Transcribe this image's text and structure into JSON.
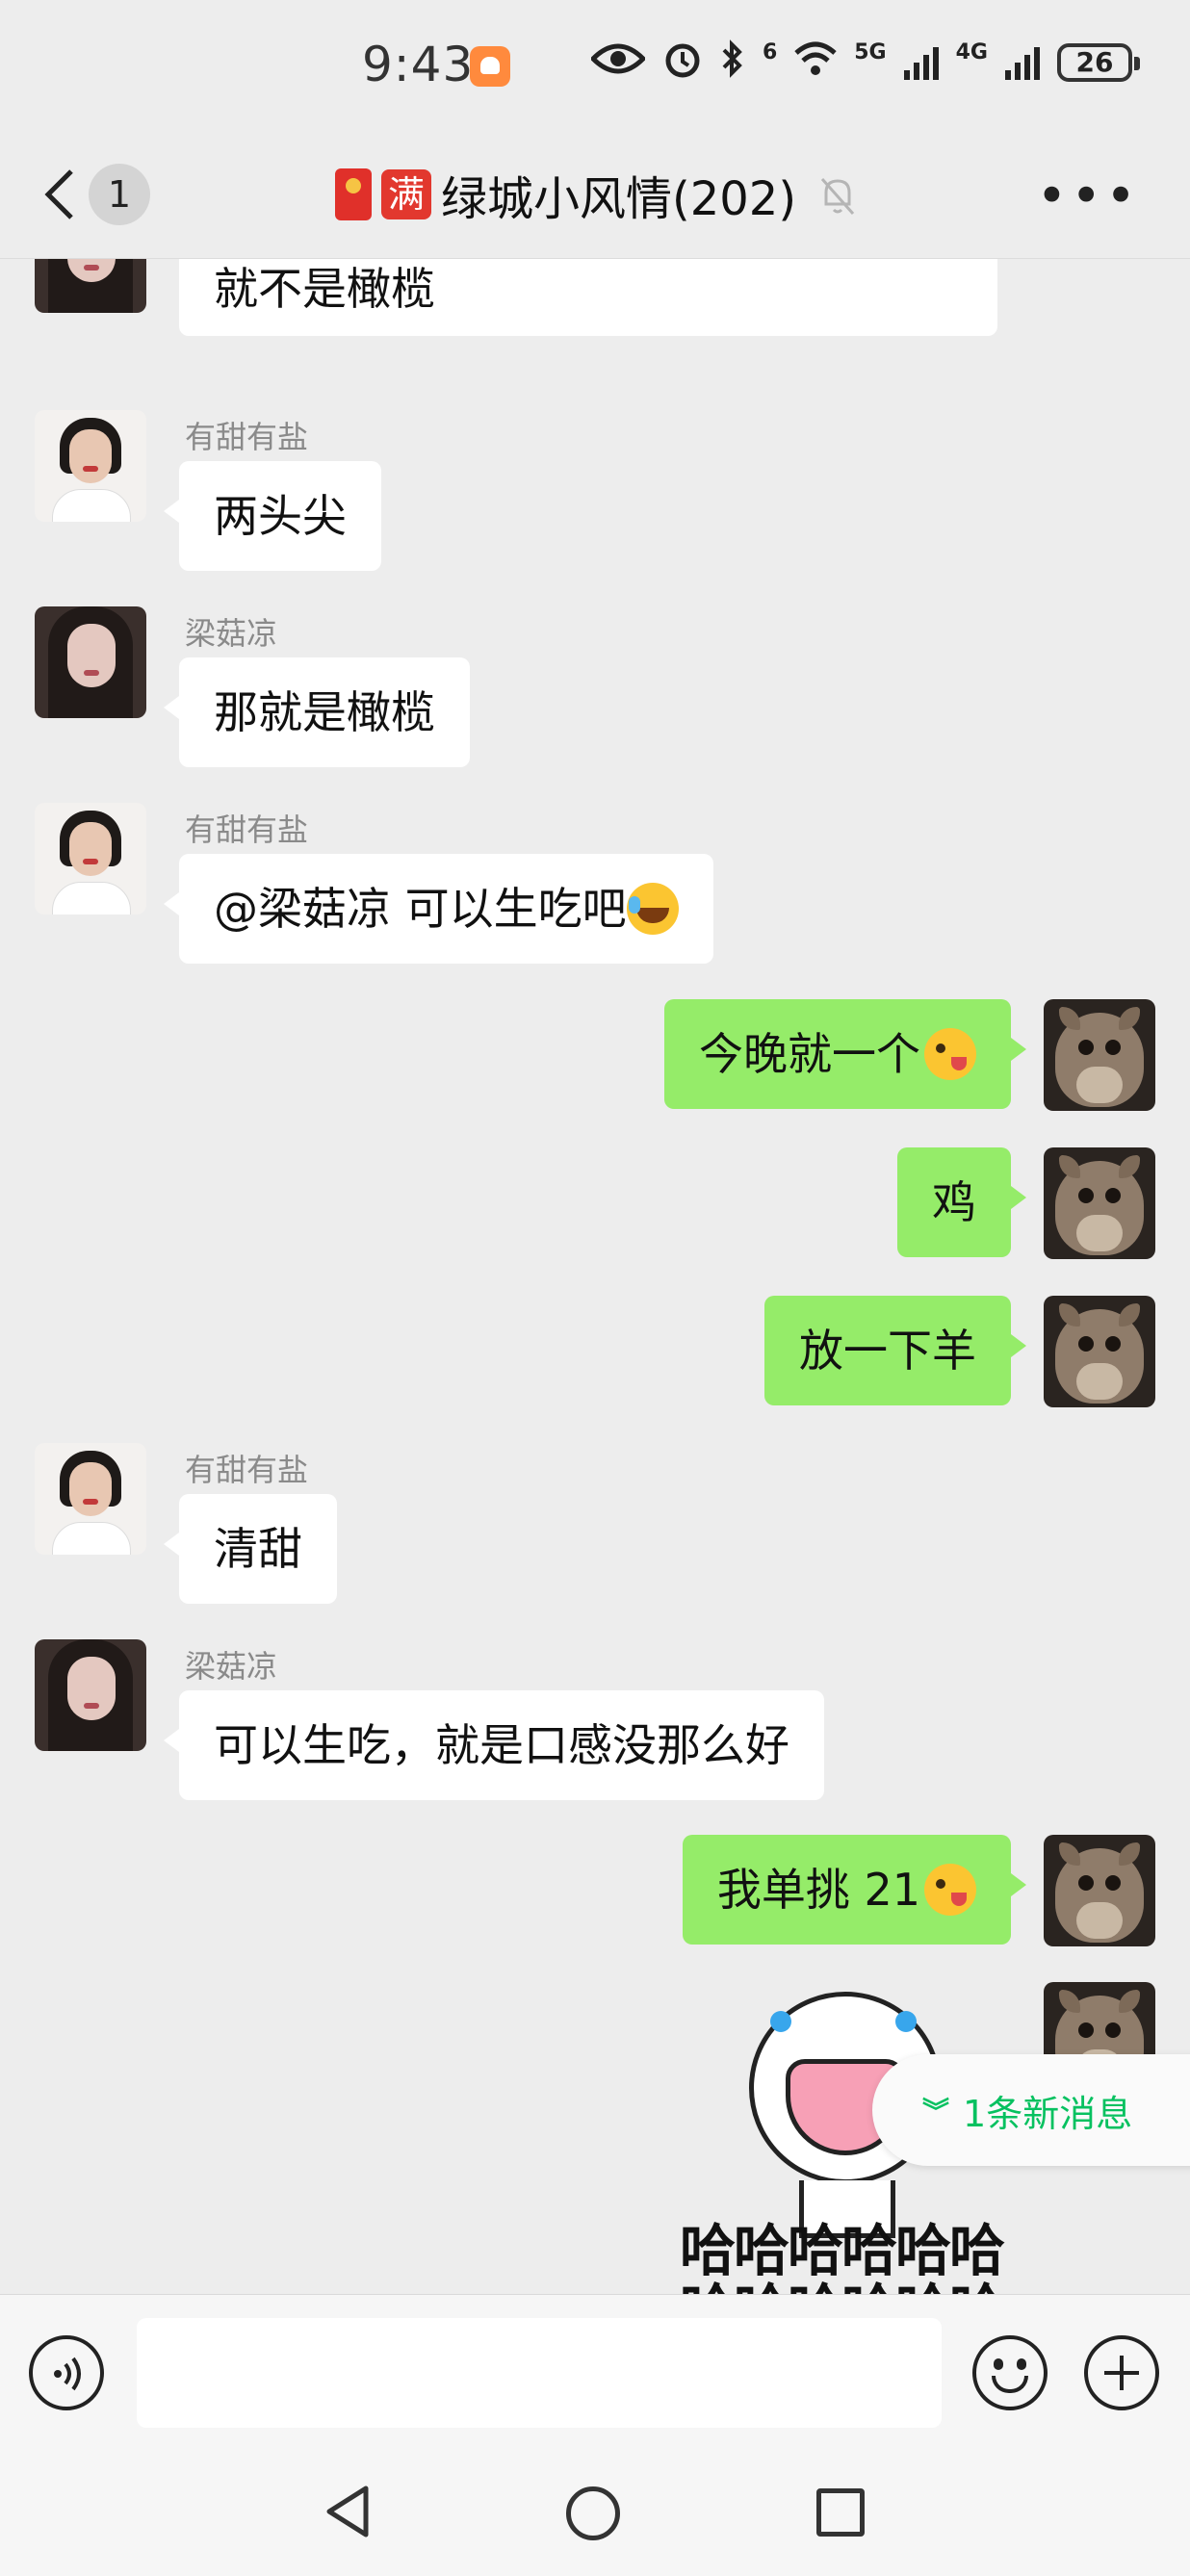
{
  "status_bar": {
    "time": "9:43",
    "battery": "26",
    "network_1": "5G",
    "network_2": "4G",
    "wifi_badge": "6",
    "icons": [
      "eye-icon",
      "alarm-icon",
      "bluetooth-icon",
      "wifi-icon",
      "signal-icon",
      "battery-icon"
    ]
  },
  "header": {
    "back_count": "1",
    "title": "绿城小风情(202)",
    "title_emoji_2": "满"
  },
  "messages": [
    {
      "side": "in",
      "sender": "",
      "text": "如果核是两头尖尖的是橄榄，圆的核就不是橄榄"
    },
    {
      "side": "in",
      "sender": "有甜有盐",
      "text": "两头尖"
    },
    {
      "side": "in",
      "sender": "梁菇凉",
      "text": "那就是橄榄"
    },
    {
      "side": "in",
      "sender": "有甜有盐",
      "text": "@梁菇凉  可以生吃吧"
    },
    {
      "side": "out",
      "text": "今晚就一个"
    },
    {
      "side": "out",
      "text": "鸡"
    },
    {
      "side": "out",
      "text": "放一下羊"
    },
    {
      "side": "in",
      "sender": "有甜有盐",
      "text": "清甜"
    },
    {
      "side": "in",
      "sender": "梁菇凉",
      "text": "可以生吃，就是口感没那么好"
    },
    {
      "side": "out",
      "text": "我单挑 21"
    }
  ],
  "sticker": {
    "text_line1": "哈哈哈哈哈哈",
    "text_line2": "哈哈哈哈哈哈"
  },
  "new_messages_pill": {
    "label": "1条新消息"
  },
  "input_bar": {
    "placeholder": ""
  }
}
